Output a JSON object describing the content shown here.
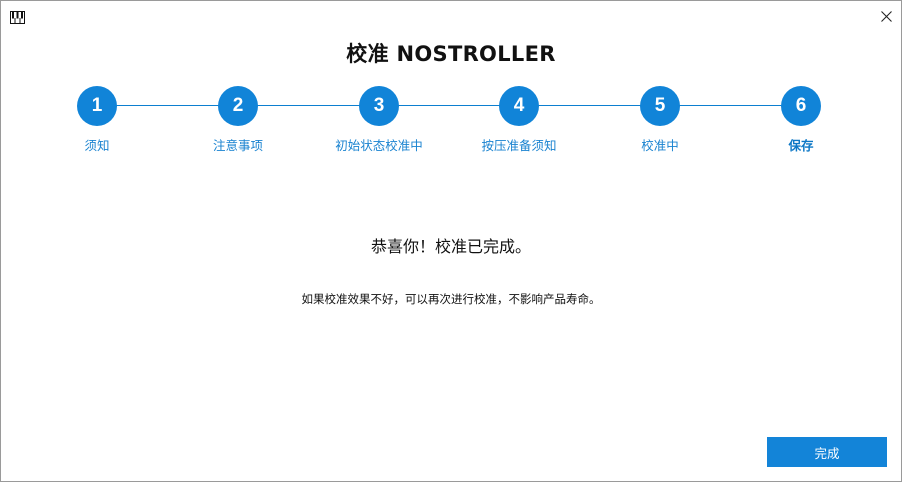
{
  "window": {
    "title": "校准 NOSTROLLER",
    "app_icon": "piano-keys-icon",
    "close_icon": "close-icon"
  },
  "steps": [
    {
      "number": "1",
      "label": "须知"
    },
    {
      "number": "2",
      "label": "注意事项"
    },
    {
      "number": "3",
      "label": "初始状态校准中"
    },
    {
      "number": "4",
      "label": "按压准备须知"
    },
    {
      "number": "5",
      "label": "校准中"
    },
    {
      "number": "6",
      "label": "保存"
    }
  ],
  "current_step": 6,
  "message": {
    "main": "恭喜你！校准已完成。",
    "sub": "如果校准效果不好，可以再次进行校准，不影响产品寿命。"
  },
  "footer": {
    "done_label": "完成"
  },
  "colors": {
    "accent": "#1184d8",
    "line": "#0c7fd0",
    "label": "#1a83d0"
  }
}
